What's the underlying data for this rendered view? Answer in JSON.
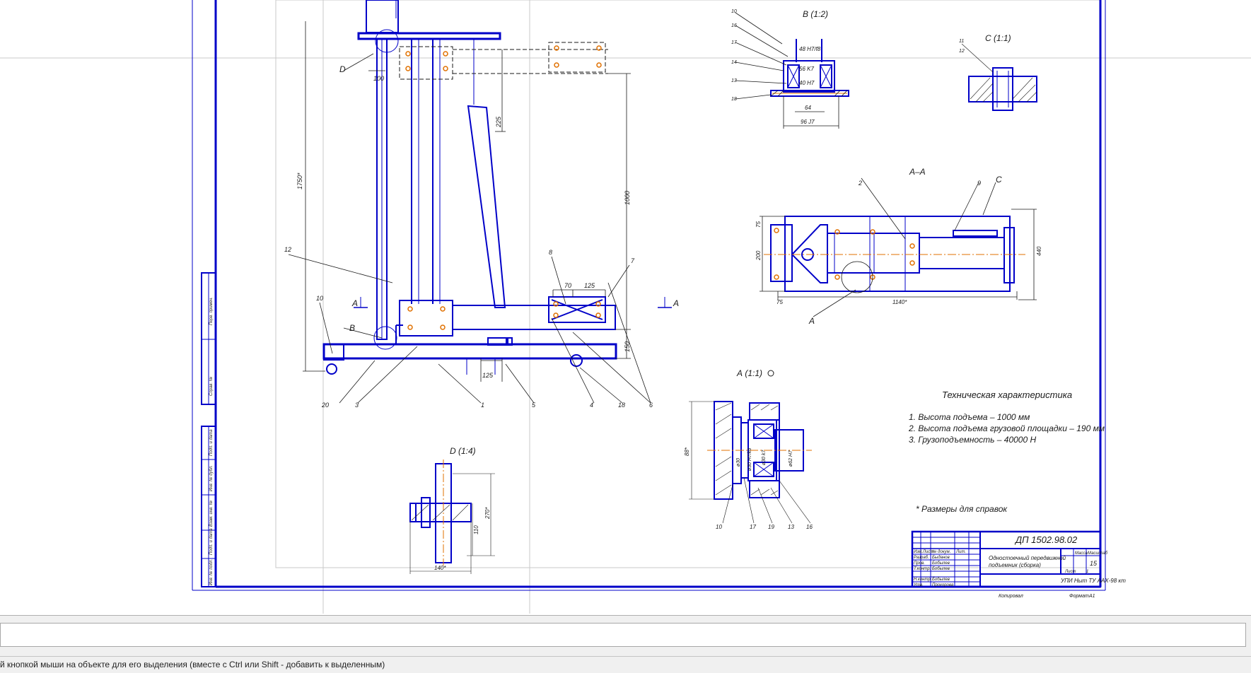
{
  "colors": {
    "line": "#0000c8",
    "center": "#e07000",
    "dim": "#1a1a1a",
    "background": "#ffffff"
  },
  "sheet": {
    "code": "ДП 1502.98.02",
    "name_line1": "Одностоечный передвижной",
    "name_line2": "подъемник (сборка)",
    "sheet_count": "15",
    "sheet_no": "1",
    "organization": "УПИ Ныт ТУ ААХ-98 кт",
    "copied_label": "Копировал",
    "format_label": "Формат",
    "format_value": "А1",
    "roles": [
      "Изм.Лист",
      "Разраб.",
      "Пров.",
      "Т.контр.",
      "Н.контр.",
      "Утв."
    ],
    "names": [
      "",
      "Быданов",
      "Бобылев",
      "Бобылев",
      "Бобылев",
      "Прохорова"
    ],
    "header_labels": [
      "№ докум.",
      "Лит.",
      "Масса",
      "Масштаб",
      "Лист",
      "Листов"
    ]
  },
  "views": {
    "b": "В (1:2)",
    "c": "С (1:1)",
    "aa": "А–А",
    "a_detail": "А (1:1)",
    "d": "D (1:4)"
  },
  "specs": {
    "title": "Техническая характеристика",
    "items": [
      "1. Высота подъема – 1000 мм",
      "2. Высота подъема грузовой площадки – 190 мм",
      "3. Грузоподъемность – 40000 Н"
    ],
    "note": "* Размеры для справок"
  },
  "dims": {
    "height_total": "1750*",
    "lift": "1000",
    "arm": "225",
    "top": "100",
    "base_h": "150",
    "base_w": "125",
    "pad_gap": "70",
    "pad_w": "125",
    "aa_h": "200",
    "aa_t": "75",
    "aa_w": "440",
    "aa_len": "1140*",
    "aa_l": "75",
    "b_d1": "48 H7/f8",
    "b_d2": "56 K7",
    "b_d3": "40 H7",
    "b_w": "64",
    "b_base": "96 J7",
    "a_h": "88*",
    "a_d1": "ø30",
    "a_d2": "ø30 H7/k6",
    "a_d3": "ø30 k7",
    "a_d4": "ø62 H7",
    "d_h1": "270*",
    "d_h2": "110",
    "d_w": "140*"
  },
  "leaders": {
    "main": [
      "12",
      "10",
      "B",
      "D",
      "A",
      "A",
      "8",
      "7",
      "20",
      "3",
      "1",
      "5",
      "4",
      "18",
      "6"
    ],
    "b": [
      "10",
      "16",
      "17",
      "14",
      "13",
      "18"
    ],
    "c": [
      "11",
      "12"
    ],
    "aa": [
      "2",
      "9",
      "C",
      "A"
    ],
    "a_detail": [
      "10",
      "17",
      "19",
      "13",
      "16"
    ]
  },
  "frame_labels": [
    "Перв. примен.",
    "Справ. №",
    "Подп. и дата",
    "Инв. № дубл.",
    "Взам. инв. №",
    "Подп. и дата",
    "Инв. № подл."
  ],
  "command": {
    "value": ""
  },
  "status": {
    "message": "й кнопкой мыши на объекте для его выделения (вместе с Ctrl или Shift - добавить к выделенным)"
  }
}
